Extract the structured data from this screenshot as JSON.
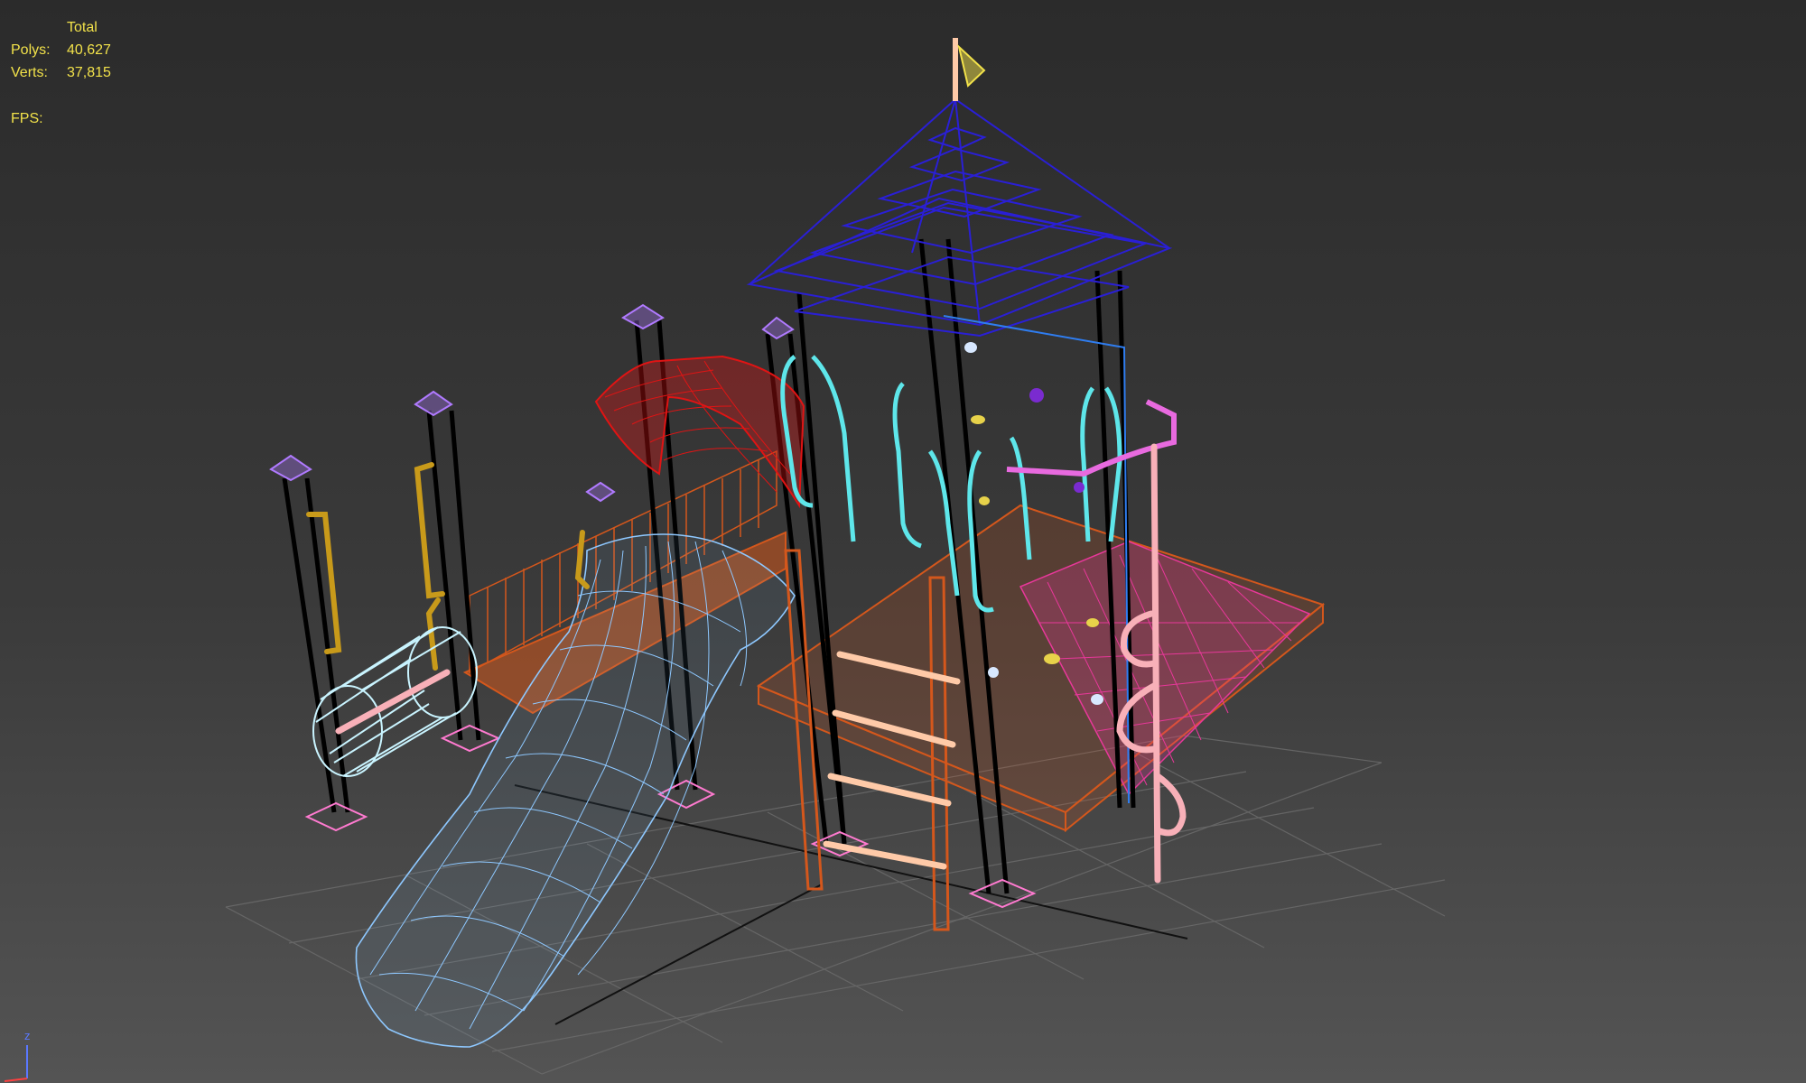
{
  "viewport": {
    "stats": {
      "header": "Total",
      "polys_label": "Polys:",
      "polys_value": "40,627",
      "verts_label": "Verts:",
      "verts_value": "37,815",
      "fps_label": "FPS:"
    },
    "gizmo": {
      "z_label": "z"
    }
  },
  "colors": {
    "stats_text": "#f2e24a",
    "roof": "#2a1fd6",
    "slide": "#8ec8ff",
    "deck": "#d4571c",
    "climbing_wall": "#e8389a",
    "hood": "#e01414",
    "handles": "#5ee6ea",
    "post_caps": "#b07aff",
    "ladder_rungs": "#ffcaa8",
    "pole": "#f8b0b8",
    "grab_bars": "#c89a1a",
    "tube": "#c9f4ff",
    "grid": "#6b6b6b"
  }
}
